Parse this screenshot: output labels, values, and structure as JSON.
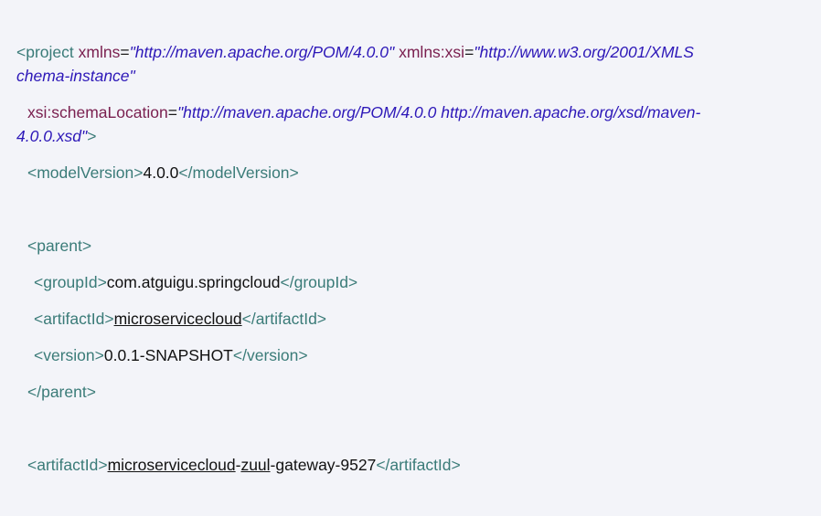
{
  "code_lines": {
    "l1": {
      "tag_open": "<project",
      "attr1": "xmlns",
      "eq": "=",
      "val1": "\"http://maven.apache.org/POM/4.0.0\"",
      "attr2": "xmlns:xsi",
      "val2": "\"http://www.w3.org/2001/XMLS"
    },
    "l2": {
      "val2_cont": "chema-instance\""
    },
    "l3": {
      "attr3": "xsi:schemaLocation",
      "val3": "\"http://maven.apache.org/POM/4.0.0 http://maven.apache.org/xsd/maven-"
    },
    "l4": {
      "val3_cont": "4.0.0.xsd\"",
      "tag_close": ">"
    },
    "l5": {
      "open": "<modelVersion>",
      "text": "4.0.0",
      "close": "</modelVersion>"
    },
    "l6": {
      "open": "<parent>"
    },
    "l7": {
      "open": "<groupId>",
      "text": "com.atguigu.springcloud",
      "close": "</groupId>"
    },
    "l8": {
      "open": "<artifactId>",
      "text": "microservicecloud",
      "close": "</artifactId>"
    },
    "l9": {
      "open": "<version>",
      "text": "0.0.1-SNAPSHOT",
      "close": "</version>"
    },
    "l10": {
      "close": "</parent>"
    },
    "l11": {
      "open": "<artifactId>",
      "text_a": "microservicecloud",
      "dash1": "-",
      "text_b": "zuul",
      "text_c": "-gateway-9527",
      "close": "</artifactId>"
    }
  }
}
